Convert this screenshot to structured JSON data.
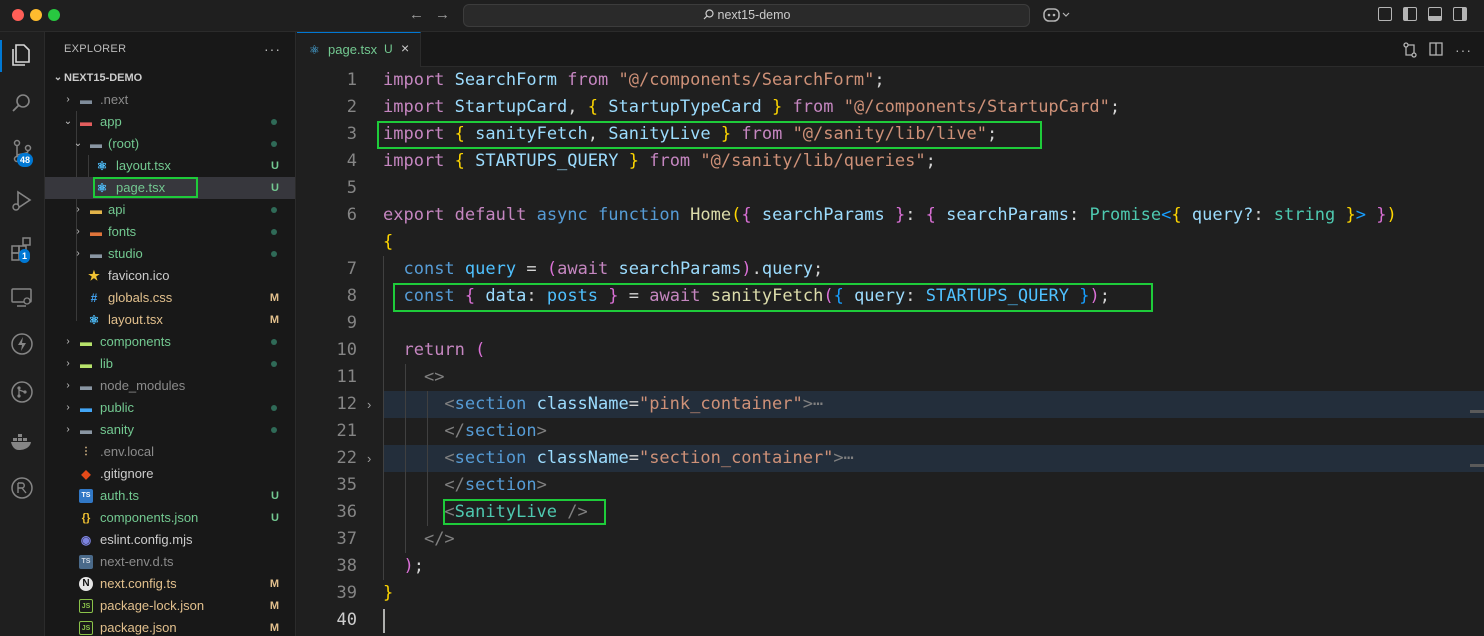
{
  "window": {
    "title": "next15-demo",
    "nav_back": "←",
    "nav_forward": "→"
  },
  "activity_bar": {
    "scm_badge": "48",
    "extensions_badge": "1"
  },
  "explorer": {
    "header": "EXPLORER",
    "more": "···",
    "root": "NEXT15-DEMO",
    "items": [
      {
        "label": ".next",
        "status": "",
        "chev": "›"
      },
      {
        "label": "app",
        "status": "",
        "chev": "⌄"
      },
      {
        "label": "(root)",
        "status": "",
        "chev": "⌄"
      },
      {
        "label": "layout.tsx",
        "status": "U"
      },
      {
        "label": "page.tsx",
        "status": "U"
      },
      {
        "label": "api",
        "status": "",
        "chev": "›"
      },
      {
        "label": "fonts",
        "status": "",
        "chev": "›"
      },
      {
        "label": "studio",
        "status": "",
        "chev": "›"
      },
      {
        "label": "favicon.ico",
        "status": ""
      },
      {
        "label": "globals.css",
        "status": "M"
      },
      {
        "label": "layout.tsx",
        "status": "M"
      },
      {
        "label": "components",
        "status": "",
        "chev": "›"
      },
      {
        "label": "lib",
        "status": "",
        "chev": "›"
      },
      {
        "label": "node_modules",
        "status": "",
        "chev": "›"
      },
      {
        "label": "public",
        "status": "",
        "chev": "›"
      },
      {
        "label": "sanity",
        "status": "",
        "chev": "›"
      },
      {
        "label": ".env.local",
        "status": ""
      },
      {
        "label": ".gitignore",
        "status": ""
      },
      {
        "label": "auth.ts",
        "status": "U"
      },
      {
        "label": "components.json",
        "status": "U"
      },
      {
        "label": "eslint.config.mjs",
        "status": ""
      },
      {
        "label": "next-env.d.ts",
        "status": ""
      },
      {
        "label": "next.config.ts",
        "status": "M"
      },
      {
        "label": "package-lock.json",
        "status": "M"
      },
      {
        "label": "package.json",
        "status": "M"
      }
    ],
    "icons": {
      "ts": "TS",
      "json": "{}",
      "npm": "JS",
      "next": "N",
      "git": "◆"
    }
  },
  "tab": {
    "name": "page.tsx",
    "status": "U",
    "close": "×"
  },
  "editor": {
    "line_numbers": [
      "1",
      "2",
      "3",
      "4",
      "5",
      "6",
      "7",
      "8",
      "9",
      "10",
      "11",
      "12",
      "21",
      "22",
      "35",
      "36",
      "37",
      "38",
      "39",
      "40"
    ],
    "fold_marker": "›",
    "ellipsis": "⋯",
    "tokens": {
      "import": "import",
      "from": "from",
      "export": "export",
      "default": "default",
      "async": "async",
      "function": "function",
      "const": "const",
      "await": "await",
      "return": "return",
      "SearchForm": "SearchForm",
      "StartupCard": "StartupCard",
      "StartupTypeCard": "StartupTypeCard",
      "sanityFetch": "sanityFetch",
      "SanityLive": "SanityLive",
      "STARTUPS_QUERY": "STARTUPS_QUERY",
      "Home": "Home",
      "searchParams": "searchParams",
      "Promise": "Promise",
      "query_opt": "query?",
      "string": "string",
      "query": "query",
      "data": "data",
      "posts": "posts",
      "section": "section",
      "className": "className",
      "s_searchform": "\"@/components/SearchForm\"",
      "s_startupcard": "\"@/components/StartupCard\"",
      "s_live": "\"@/sanity/lib/live\"",
      "s_queries": "\"@/sanity/lib/queries\"",
      "s_pink": "\"pink_container\"",
      "s_section": "\"section_container\""
    }
  }
}
